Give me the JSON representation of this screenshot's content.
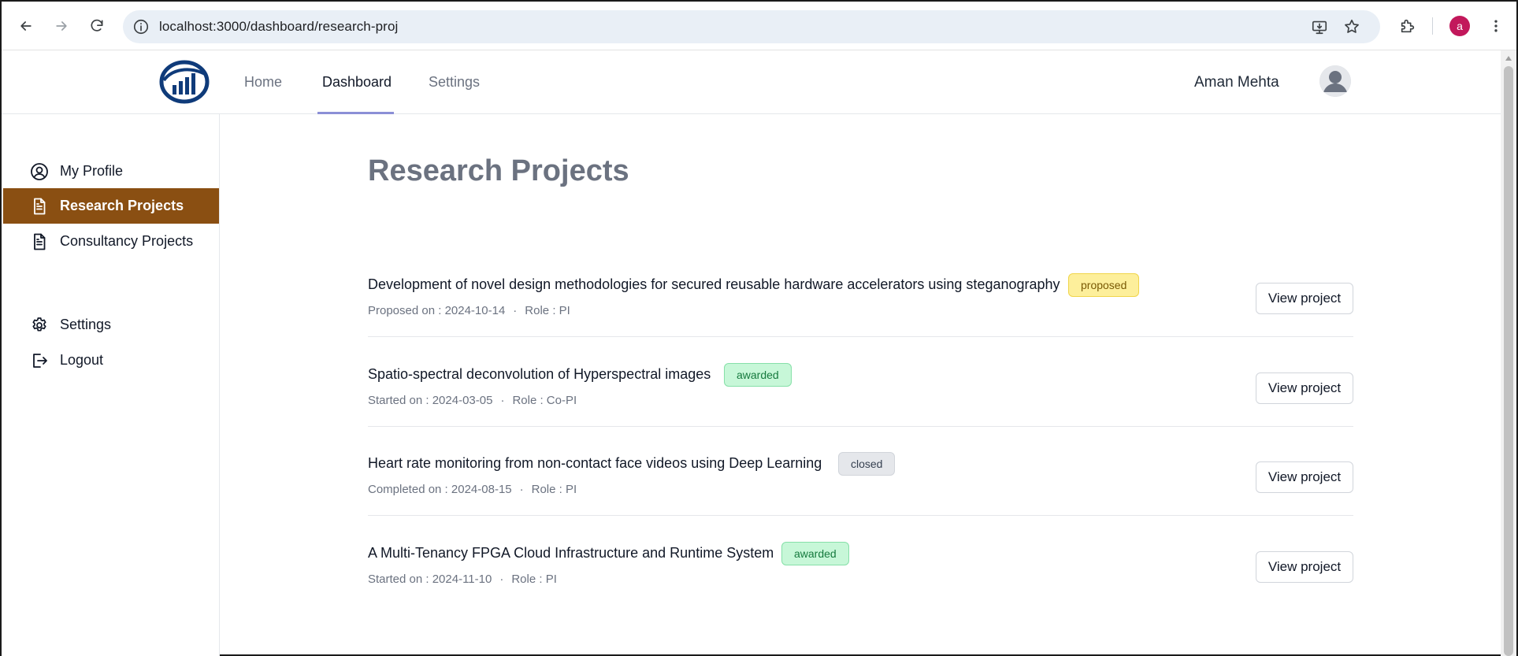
{
  "browser": {
    "url": "localhost:3000/dashboard/research-proj",
    "profile_initial": "a"
  },
  "header": {
    "nav": [
      {
        "label": "Home",
        "active": false
      },
      {
        "label": "Dashboard",
        "active": true
      },
      {
        "label": "Settings",
        "active": false
      }
    ],
    "username": "Aman Mehta"
  },
  "sidebar": {
    "items": [
      {
        "label": "My Profile",
        "icon": "user-circle-icon",
        "active": false
      },
      {
        "label": "Research Projects",
        "icon": "document-icon",
        "active": true
      },
      {
        "label": "Consultancy Projects",
        "icon": "document-icon",
        "active": false
      },
      {
        "label": "Settings",
        "icon": "gear-icon",
        "active": false
      },
      {
        "label": "Logout",
        "icon": "logout-icon",
        "active": false
      }
    ]
  },
  "main": {
    "title": "Research Projects",
    "view_label": "View project",
    "projects": [
      {
        "title": "Development of novel design methodologies for secured reusable hardware accelerators using steganography",
        "status": "proposed",
        "date_label": "Proposed on : 2024-10-14",
        "role": "Role : PI"
      },
      {
        "title": "Spatio-spectral deconvolution of Hyperspectral images",
        "status": "awarded",
        "date_label": "Started on : 2024-03-05",
        "role": "Role : Co-PI"
      },
      {
        "title": "Heart rate monitoring from non-contact face videos using Deep Learning",
        "status": "closed",
        "date_label": "Completed on : 2024-08-15",
        "role": "Role : PI"
      },
      {
        "title": "A Multi-Tenancy FPGA Cloud Infrastructure and Runtime System",
        "status": "awarded",
        "date_label": "Started on : 2024-11-10",
        "role": "Role : PI"
      }
    ]
  },
  "colors": {
    "sidebar_active": "#8a4f12",
    "proposed_badge": "#fdef9b",
    "awarded_badge": "#c7f7d8",
    "closed_badge": "#e5e7eb"
  }
}
